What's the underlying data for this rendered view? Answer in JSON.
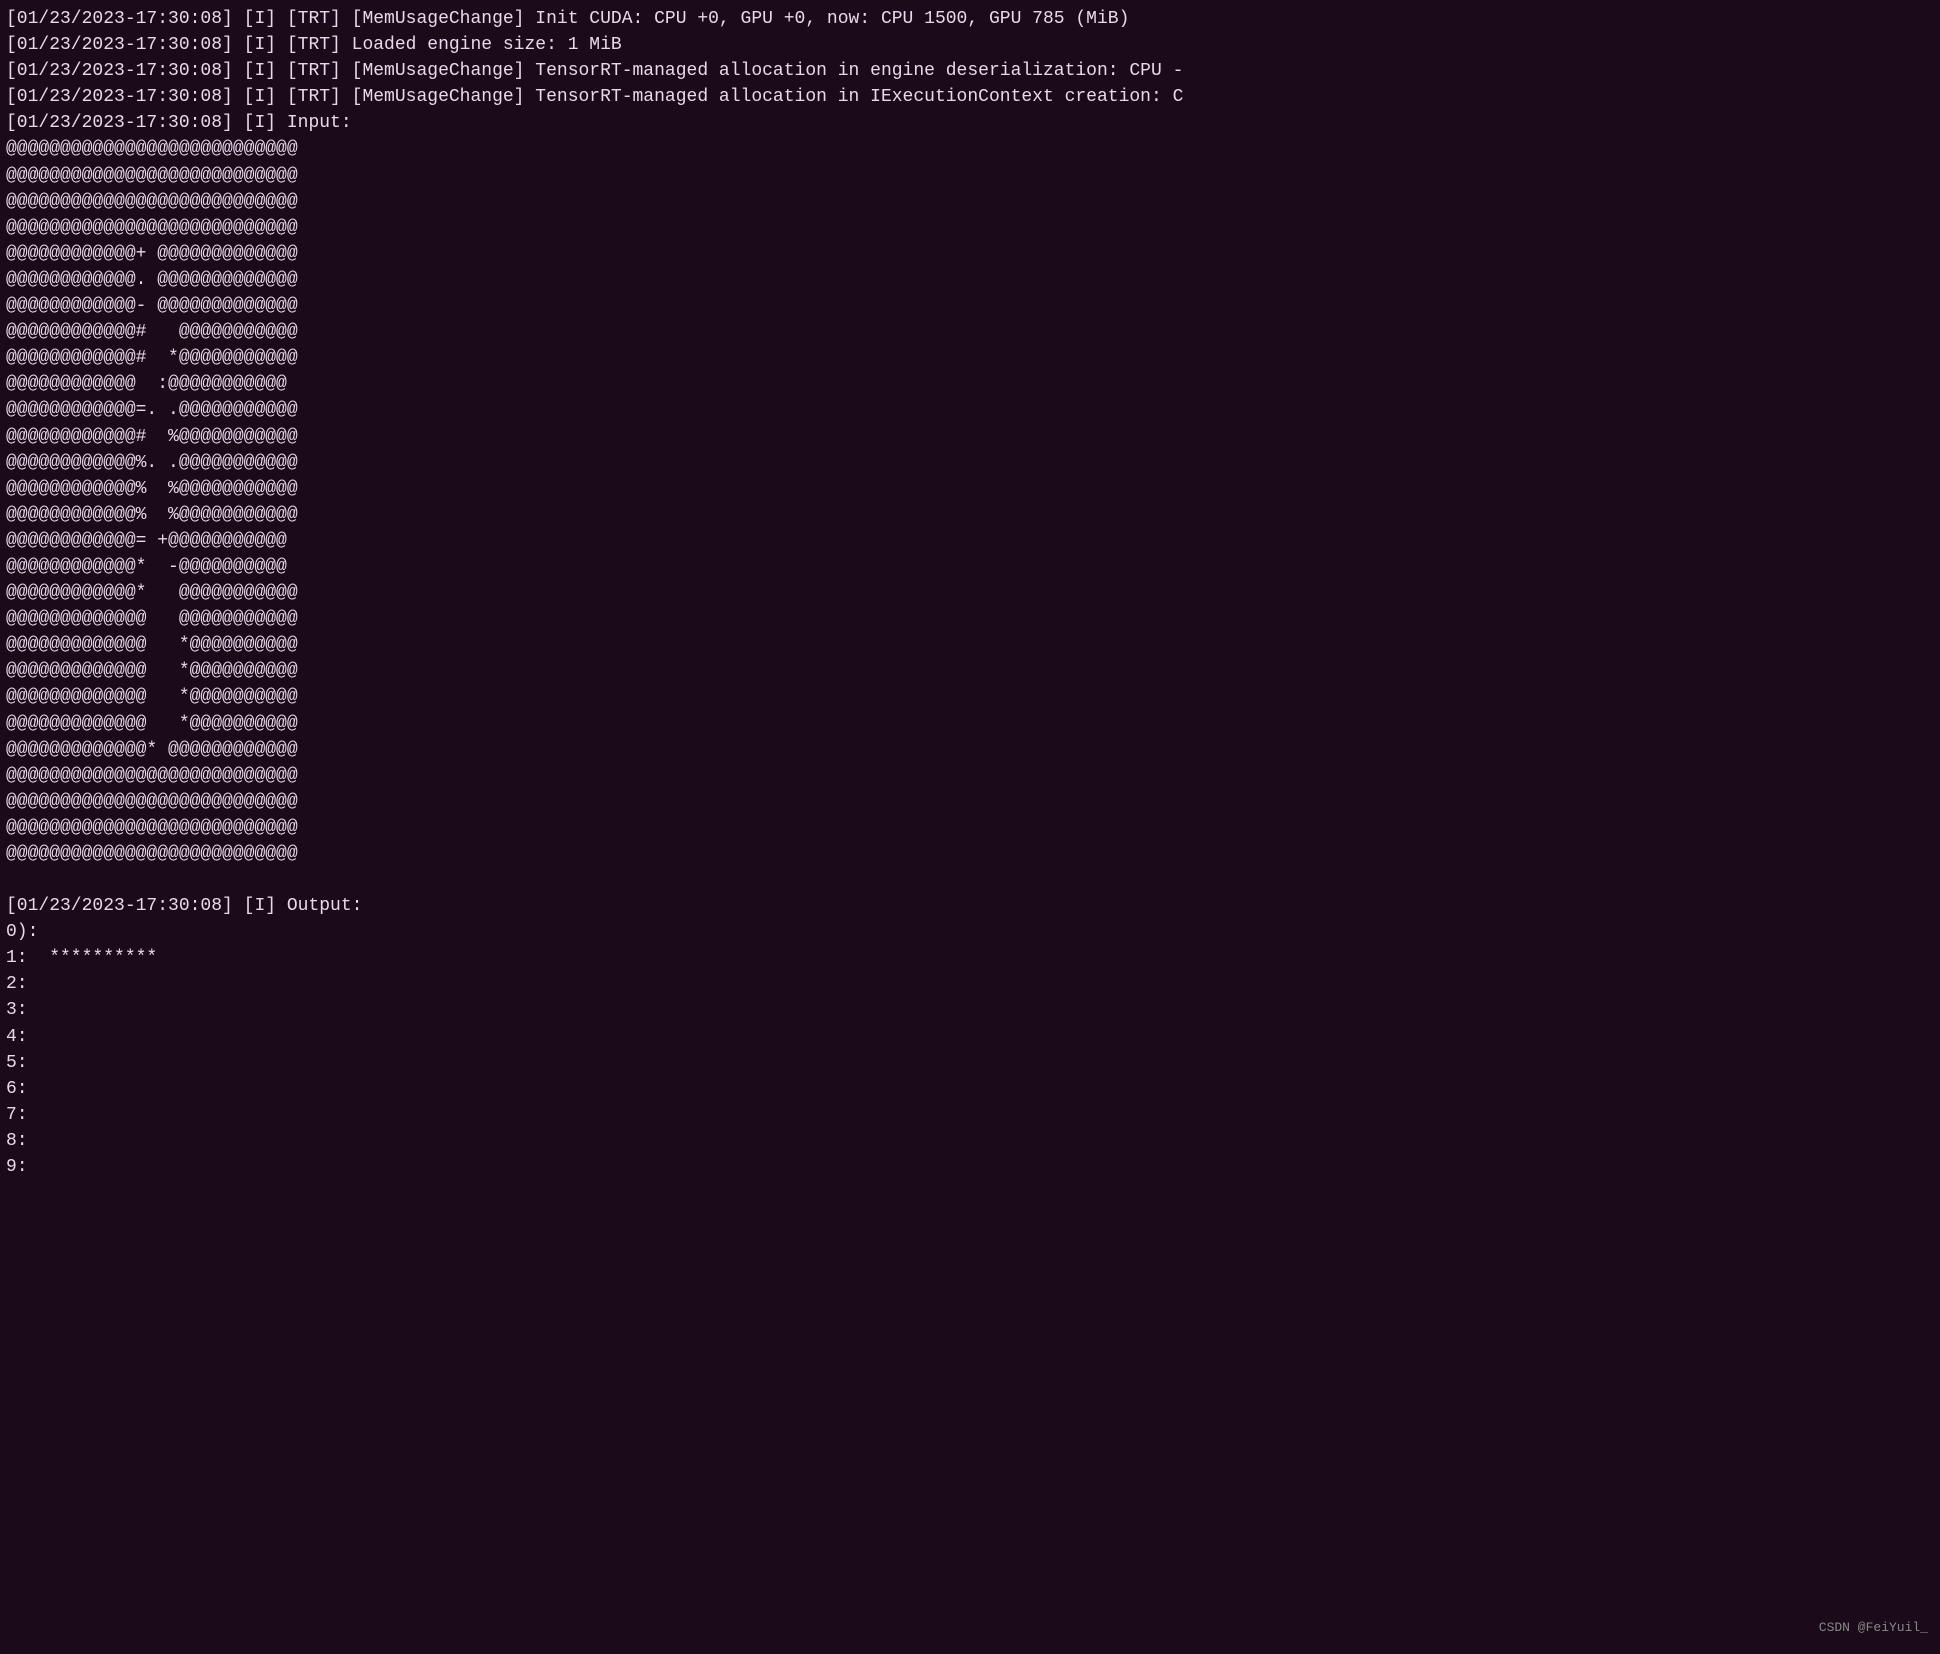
{
  "terminal": {
    "log_lines": [
      "[01/23/2023-17:30:08] [I] [TRT] [MemUsageChange] Init CUDA: CPU +0, GPU +0, now: CPU 1500, GPU 785 (MiB)",
      "[01/23/2023-17:30:08] [I] [TRT] Loaded engine size: 1 MiB",
      "[01/23/2023-17:30:08] [I] [TRT] [MemUsageChange] TensorRT-managed allocation in engine deserialization: CPU -",
      "[01/23/2023-17:30:08] [I] [TRT] [MemUsageChange] TensorRT-managed allocation in IExecutionContext creation: C",
      "[01/23/2023-17:30:08] [I] Input:"
    ],
    "ascii_art": [
      "@@@@@@@@@@@@@@@@@@@@@@@@@@@",
      "@@@@@@@@@@@@@@@@@@@@@@@@@@@",
      "@@@@@@@@@@@@@@@@@@@@@@@@@@@",
      "@@@@@@@@@@@@@@@@@@@@@@@@@@@",
      "@@@@@@@@@@@@+ @@@@@@@@@@@@@",
      "@@@@@@@@@@@@. @@@@@@@@@@@@@",
      "@@@@@@@@@@@@- @@@@@@@@@@@@@",
      "@@@@@@@@@@@@#   @@@@@@@@@@@",
      "@@@@@@@@@@@@#  *@@@@@@@@@@@",
      "@@@@@@@@@@@@  :@@@@@@@@@@@",
      "@@@@@@@@@@@@=. .@@@@@@@@@@@",
      "@@@@@@@@@@@@#  %@@@@@@@@@@@",
      "@@@@@@@@@@@@%. .@@@@@@@@@@@",
      "@@@@@@@@@@@@%  %@@@@@@@@@@@",
      "@@@@@@@@@@@@%  %@@@@@@@@@@@",
      "@@@@@@@@@@@@= +@@@@@@@@@@@",
      "@@@@@@@@@@@@*  -@@@@@@@@@@",
      "@@@@@@@@@@@@*   @@@@@@@@@@@",
      "@@@@@@@@@@@@@   @@@@@@@@@@@",
      "@@@@@@@@@@@@@   *@@@@@@@@@@",
      "@@@@@@@@@@@@@   *@@@@@@@@@@",
      "@@@@@@@@@@@@@   *@@@@@@@@@@",
      "@@@@@@@@@@@@@   *@@@@@@@@@@",
      "@@@@@@@@@@@@@* @@@@@@@@@@@@",
      "@@@@@@@@@@@@@@@@@@@@@@@@@@@",
      "@@@@@@@@@@@@@@@@@@@@@@@@@@@",
      "@@@@@@@@@@@@@@@@@@@@@@@@@@@",
      "@@@@@@@@@@@@@@@@@@@@@@@@@@@"
    ],
    "output_section": {
      "header": "[01/23/2023-17:30:08] [I] Output:",
      "lines": [
        "0):",
        "1:  **********",
        "2:",
        "3:",
        "4:",
        "5:",
        "6:",
        "7:",
        "8:",
        "9:"
      ]
    },
    "watermark": "CSDN @FeiYuil_"
  }
}
